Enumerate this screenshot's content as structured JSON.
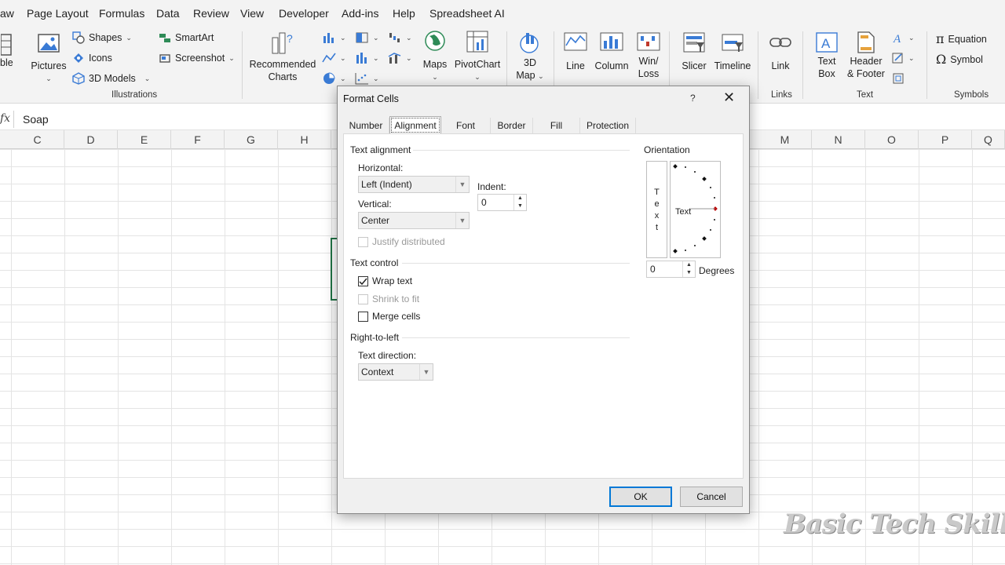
{
  "menubar": {
    "items": [
      "aw",
      "Page Layout",
      "Formulas",
      "Data",
      "Review",
      "View",
      "Developer",
      "Add-ins",
      "Help",
      "Spreadsheet AI"
    ]
  },
  "ribbon": {
    "table_partial": "ble",
    "pictures": "Pictures",
    "shapes": "Shapes",
    "icons": "Icons",
    "models_3d": "3D Models",
    "smartart": "SmartArt",
    "screenshot": "Screenshot",
    "illustrations_group": "Illustrations",
    "recommended_charts_1": "Recommended",
    "recommended_charts_2": "Charts",
    "maps": "Maps",
    "pivotchart": "PivotChart",
    "map3d_1": "3D",
    "map3d_2": "Map",
    "line": "Line",
    "column": "Column",
    "winloss_1": "Win/",
    "winloss_2": "Loss",
    "slicer": "Slicer",
    "timeline": "Timeline",
    "link": "Link",
    "links_group": "Links",
    "textbox_1": "Text",
    "textbox_2": "Box",
    "header_1": "Header",
    "header_2": "& Footer",
    "text_group": "Text",
    "equation": "Equation",
    "symbol": "Symbol",
    "symbols_group": "Symbols"
  },
  "formula_bar": {
    "fx": "fx",
    "value": "Soap"
  },
  "columns": [
    "C",
    "D",
    "E",
    "F",
    "G",
    "H",
    "M",
    "N",
    "O",
    "P",
    "Q"
  ],
  "dialog": {
    "title": "Format Cells",
    "help": "?",
    "close": "✕",
    "tabs": [
      "Number",
      "Alignment",
      "Font",
      "Border",
      "Fill",
      "Protection"
    ],
    "active_tab": "Alignment",
    "text_alignment": {
      "section": "Text alignment",
      "horizontal_label": "Horizontal:",
      "horizontal_value": "Left (Indent)",
      "vertical_label": "Vertical:",
      "vertical_value": "Center",
      "indent_label": "Indent:",
      "indent_value": "0",
      "justify_distributed": "Justify distributed"
    },
    "text_control": {
      "section": "Text control",
      "wrap_text": "Wrap text",
      "wrap_checked": true,
      "shrink_to_fit": "Shrink to fit",
      "merge_cells": "Merge cells"
    },
    "rtl": {
      "section": "Right-to-left",
      "direction_label": "Text direction:",
      "direction_value": "Context"
    },
    "orientation": {
      "section": "Orientation",
      "vertical_text": [
        "T",
        "e",
        "x",
        "t"
      ],
      "dial_text": "Text",
      "degrees_value": "0",
      "degrees_label": "Degrees"
    },
    "ok": "OK",
    "cancel": "Cancel"
  },
  "watermark": "Basic Tech Skills",
  "colors": {
    "accent": "#0078d7",
    "excel_green": "#217346"
  }
}
